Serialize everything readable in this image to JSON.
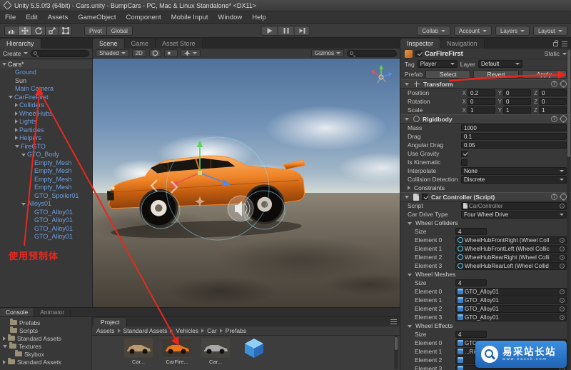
{
  "window": {
    "title": "Unity 5.5.0f3 (64bit) - Cars.unity - BumpCars - PC, Mac & Linux Standalone* <DX11>"
  },
  "menu": {
    "items": [
      "File",
      "Edit",
      "Assets",
      "GameObject",
      "Component",
      "Mobile Input",
      "Window",
      "Help"
    ]
  },
  "toolbar": {
    "pivot": "Pivot",
    "global": "Global",
    "collab": "Collab",
    "account": "Account",
    "layers": "Layers",
    "layout": "Layout"
  },
  "hierarchy": {
    "tab": "Hierarchy",
    "create_label": "Create",
    "items": [
      {
        "label": "Cars*"
      },
      {
        "label": "Ground"
      },
      {
        "label": "Sun"
      },
      {
        "label": "Main Camera"
      },
      {
        "label": "CarFireFirst"
      },
      {
        "label": "Colliders"
      },
      {
        "label": "WheelHubs"
      },
      {
        "label": "Lights"
      },
      {
        "label": "Particles"
      },
      {
        "label": "Helpers"
      },
      {
        "label": "FireGTO"
      },
      {
        "label": "GTO_Body"
      },
      {
        "label": "Empty_Mesh"
      },
      {
        "label": "Empty_Mesh"
      },
      {
        "label": "Empty_Mesh"
      },
      {
        "label": "Empty_Mesh"
      },
      {
        "label": "GTO_Spoiler01"
      },
      {
        "label": "Alloys01"
      },
      {
        "label": "GTO_Alloy01"
      },
      {
        "label": "GTO_Alloy01"
      },
      {
        "label": "GTO_Alloy01"
      },
      {
        "label": "GTO_Alloy01"
      }
    ],
    "annotation": "使用预制体"
  },
  "scene": {
    "tabs": [
      "Scene",
      "Game",
      "Asset Store"
    ],
    "shaded_label": "Shaded",
    "btn_2d": "2D",
    "gizmos_label": "Gizmos"
  },
  "inspector": {
    "tab": "Inspector",
    "tab2": "Navigation",
    "name": "CarFireFirst",
    "static_label": "Static",
    "tag_label": "Tag",
    "tag_value": "Player",
    "layer_label": "Layer",
    "layer_value": "Default",
    "prefab_label": "Prefab",
    "prefab_select": "Select",
    "prefab_revert": "Revert",
    "prefab_apply": "Apply",
    "transform": {
      "title": "Transform",
      "x": "X",
      "y": "Y",
      "z": "Z",
      "position_label": "Position",
      "rotation_label": "Rotation",
      "scale_label": "Scale",
      "position": {
        "x": "0.2",
        "y": "0",
        "z": "0"
      },
      "rotation": {
        "x": "0",
        "y": "0",
        "z": "0"
      },
      "scale": {
        "x": "1",
        "y": "1",
        "z": "1"
      }
    },
    "rigidbody": {
      "title": "Rigidbody",
      "mass_label": "Mass",
      "mass": "1000",
      "drag_label": "Drag",
      "drag": "0.1",
      "angular_drag_label": "Angular Drag",
      "angular_drag": "0.05",
      "use_gravity_label": "Use Gravity",
      "is_kinematic_label": "Is Kinematic",
      "interpolate_label": "Interpolate",
      "interpolate": "None",
      "collision_label": "Collision Detection",
      "collision": "Discrete",
      "constraints_label": "Constraints"
    },
    "car_controller": {
      "title": "Car Controller (Script)",
      "script_label": "Script",
      "script_value": "CarController",
      "drive_label": "Car Drive Type",
      "drive_value": "Four Wheel Drive",
      "wheel_colliders": {
        "title": "Wheel Colliders",
        "size_label": "Size",
        "size": "4",
        "elements": [
          {
            "label": "Element 0",
            "value": "WheelHubFrontRight (Wheel Coll"
          },
          {
            "label": "Element 1",
            "value": "WheelHubFrontLeft (Wheel Collic"
          },
          {
            "label": "Element 2",
            "value": "WheelHubRearRight (Wheel Colli"
          },
          {
            "label": "Element 3",
            "value": "WheelHubRearLeft (Wheel Collid"
          }
        ]
      },
      "wheel_meshes": {
        "title": "Wheel Meshes",
        "size_label": "Size",
        "size": "4",
        "elements": [
          {
            "label": "Element 0",
            "value": "GTO_Alloy01"
          },
          {
            "label": "Element 1",
            "value": "GTO_Alloy01"
          },
          {
            "label": "Element 2",
            "value": "GTO_Alloy01"
          },
          {
            "label": "Element 3",
            "value": "GTO_Alloy01"
          }
        ]
      },
      "wheel_effects": {
        "title": "Wheel Effects",
        "size_label": "Size",
        "size": "4",
        "elements": [
          {
            "label": "Element 0",
            "value": "GTO_Alloys"
          },
          {
            "label": "Element 1",
            "value": "...Right (WheelEffe"
          },
          {
            "label": "Element 2",
            "value": ""
          },
          {
            "label": "Element 3",
            "value": ""
          }
        ]
      }
    }
  },
  "bottom": {
    "console_tab": "Console",
    "animator_tab": "Animator",
    "project_tab": "Project",
    "folders": [
      {
        "label": "Prefabs"
      },
      {
        "label": "Scripts"
      },
      {
        "label": "Standard Assets"
      },
      {
        "label": "Textures"
      },
      {
        "label": "Skybox"
      },
      {
        "label": "Standard Assets"
      }
    ],
    "breadcrumb": [
      "Assets",
      "Standard Assets",
      "Vehicles",
      "Car",
      "Prefabs"
    ],
    "assets": [
      {
        "label": "Car..."
      },
      {
        "label": "CarFire..."
      },
      {
        "label": "Car..."
      },
      {
        "label": ""
      }
    ]
  },
  "watermark": {
    "text": "易采站长站",
    "subtext": "www.easck.com"
  },
  "colors": {
    "annotation_red": "#e8281e",
    "prefab_blue": "#6f9edf"
  }
}
